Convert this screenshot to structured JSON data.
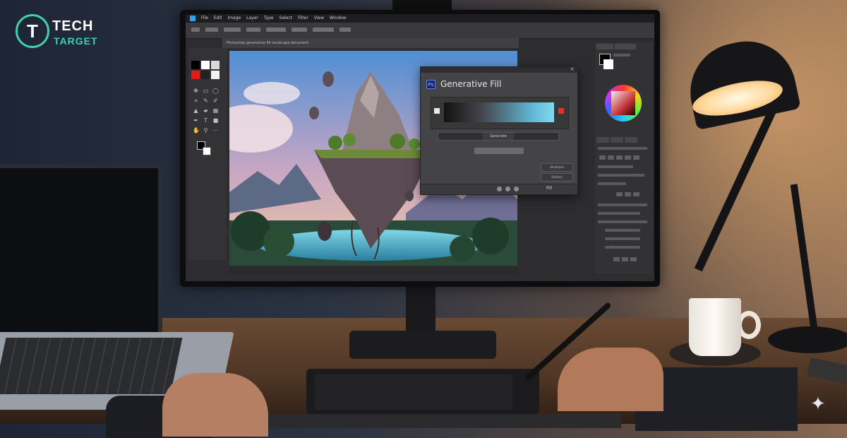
{
  "brand": {
    "mark": "T",
    "line1": "TECH",
    "line2": "TARGET"
  },
  "photoshop": {
    "menu": [
      "File",
      "Edit",
      "Image",
      "Layer",
      "Type",
      "Select",
      "Filter",
      "View",
      "Window"
    ],
    "document_tab": "Photoshop generative fill landscape document",
    "dialog": {
      "icon": "Ps",
      "title": "Generative Fill",
      "generate_label": "Generate",
      "side_buttons": [
        "Variations",
        "Options"
      ],
      "footer_label": "Fill"
    }
  },
  "colors": {
    "accent_teal": "#3fd0b4",
    "ps_blue": "#2fa3f6",
    "gradient_end": "#83d8ef",
    "stop_red": "#e0352a"
  },
  "icons": [
    "close-icon",
    "brush-icon",
    "color-wheel-icon",
    "sparkle-icon"
  ]
}
